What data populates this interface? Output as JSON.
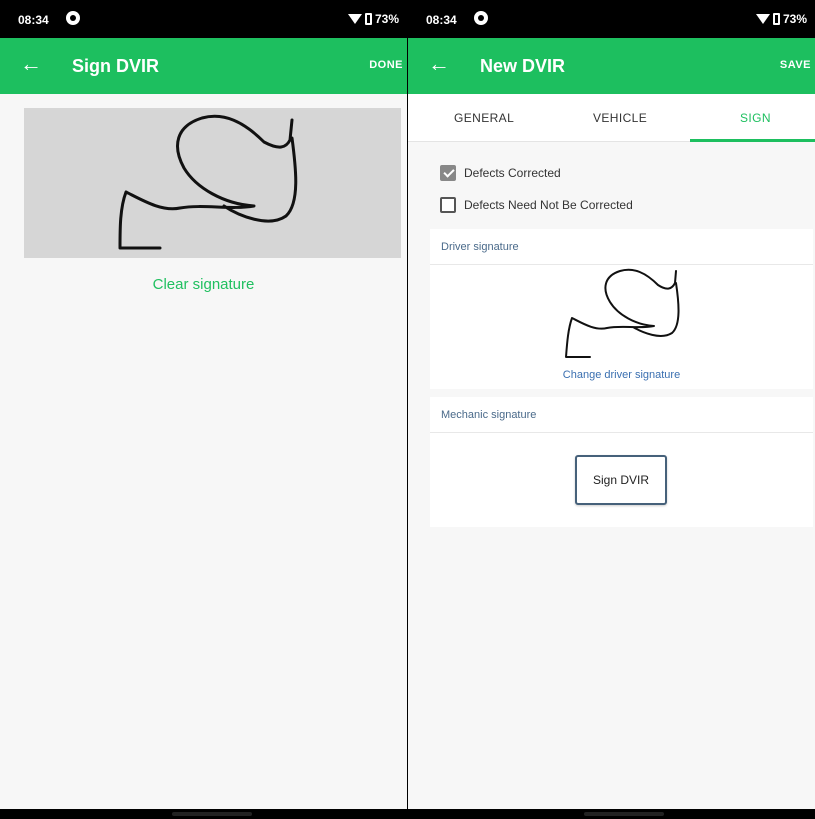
{
  "left_screen": {
    "status": {
      "time": "08:34",
      "battery": "73%"
    },
    "appbar": {
      "back": "←",
      "title": "Sign DVIR",
      "action": "DONE"
    },
    "clear_signature": "Clear signature"
  },
  "right_screen": {
    "status": {
      "time": "08:34",
      "battery": "73%"
    },
    "appbar": {
      "back": "←",
      "title": "New DVIR",
      "action": "SAVE"
    },
    "tabs": [
      "GENERAL",
      "VEHICLE",
      "SIGN"
    ],
    "active_tab": "SIGN",
    "checkboxes": [
      {
        "label": "Defects Corrected",
        "checked": true
      },
      {
        "label": "Defects Need Not Be Corrected",
        "checked": false
      }
    ],
    "driver_signature_header": "Driver signature",
    "change_driver_signature": "Change driver signature",
    "mechanic_signature_header": "Mechanic signature",
    "sign_button": "Sign DVIR"
  },
  "colors": {
    "accent_green": "#1dbf5f",
    "link_blue": "#3a6fb0"
  }
}
